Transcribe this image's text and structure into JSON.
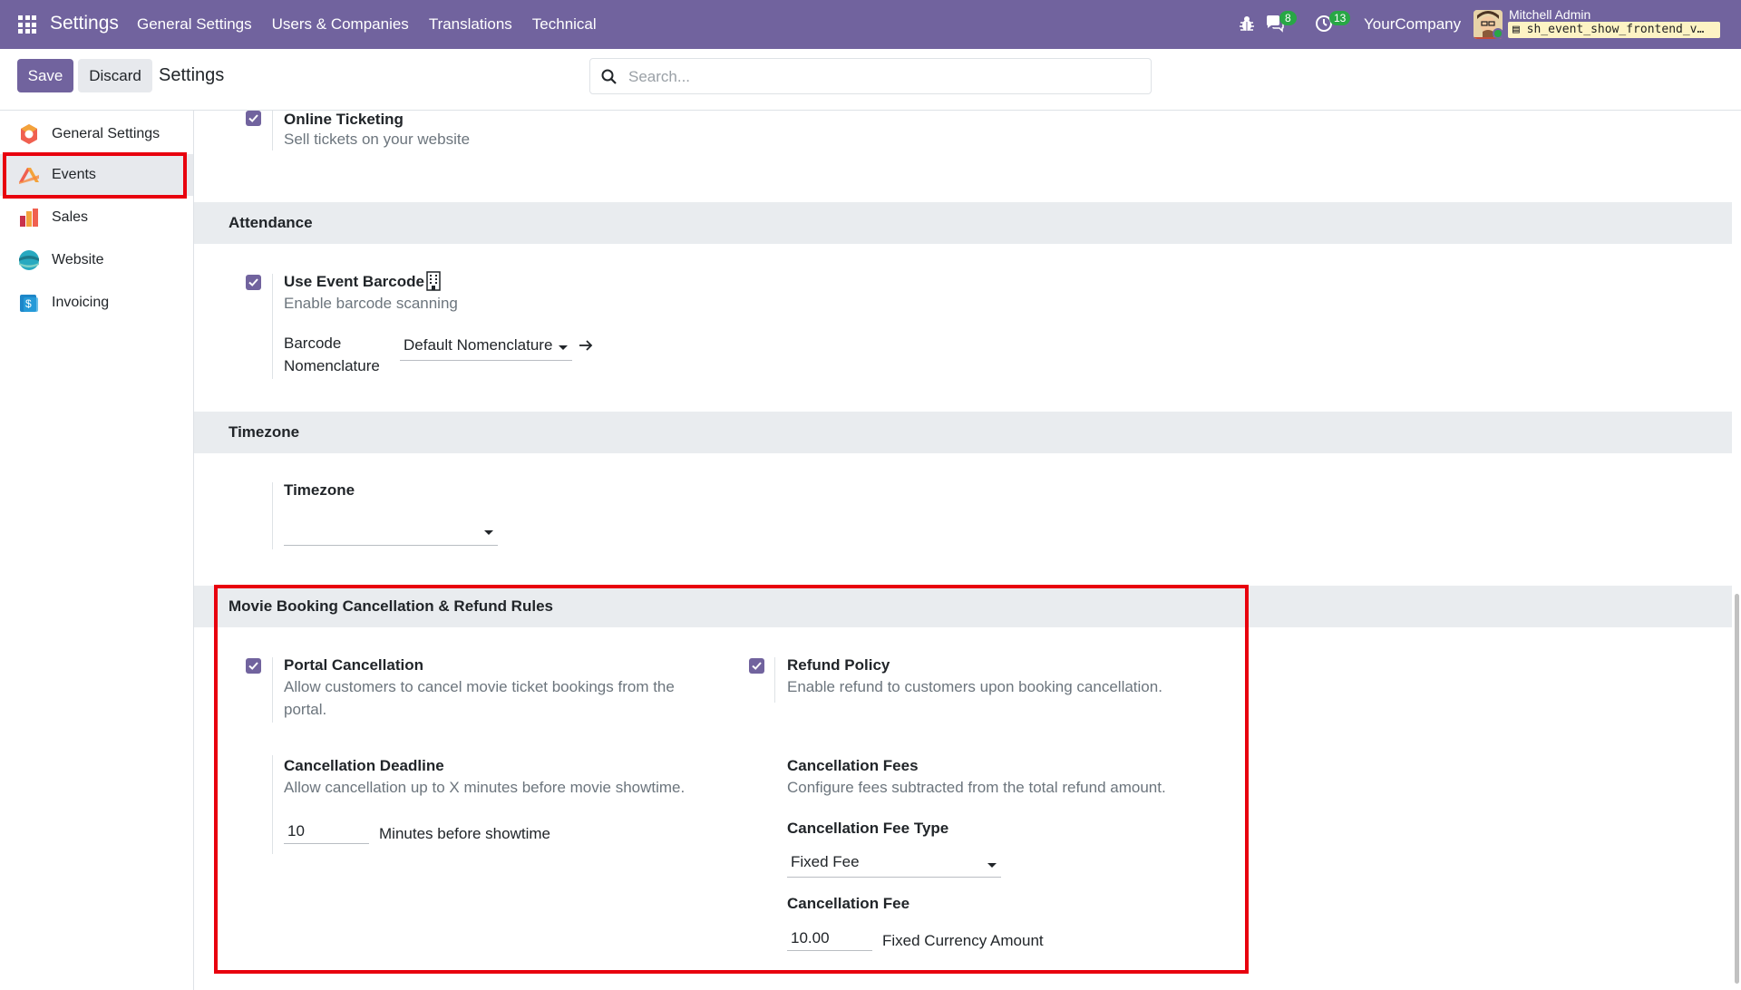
{
  "navbar": {
    "brand": "Settings",
    "menu": [
      "General Settings",
      "Users & Companies",
      "Translations",
      "Technical"
    ],
    "chat_count": "8",
    "activity_count": "13",
    "company": "YourCompany",
    "user_name": "Mitchell Admin",
    "db_name": "sh_event_show_frontend_v…",
    "bg_color": "#71639e"
  },
  "control_panel": {
    "save_label": "Save",
    "discard_label": "Discard",
    "title": "Settings",
    "search_placeholder": "Search..."
  },
  "sidebar": {
    "items": [
      {
        "label": "General Settings",
        "icon": "settings-app-icon"
      },
      {
        "label": "Events",
        "icon": "events-app-icon",
        "active": true
      },
      {
        "label": "Sales",
        "icon": "sales-app-icon"
      },
      {
        "label": "Website",
        "icon": "website-app-icon"
      },
      {
        "label": "Invoicing",
        "icon": "invoicing-app-icon"
      }
    ]
  },
  "main": {
    "online_ticketing": {
      "title": "Online Ticketing",
      "desc": "Sell tickets on your website",
      "checked": true
    },
    "attendance": {
      "header": "Attendance",
      "barcode_title": "Use Event Barcode",
      "barcode_desc": "Enable barcode scanning",
      "barcode_checked": true,
      "nomenclature_label_1": "Barcode",
      "nomenclature_label_2": "Nomenclature",
      "nomenclature_value": "Default Nomenclature"
    },
    "timezone": {
      "header": "Timezone",
      "label": "Timezone",
      "value": ""
    },
    "movie_rules": {
      "header": "Movie Booking Cancellation & Refund Rules",
      "portal_title": "Portal Cancellation",
      "portal_desc_1": "Allow customers to cancel movie ticket bookings from the",
      "portal_desc_2": "portal.",
      "portal_checked": true,
      "refund_title": "Refund Policy",
      "refund_desc": "Enable refund to customers upon booking cancellation.",
      "refund_checked": true,
      "deadline_title": "Cancellation Deadline",
      "deadline_desc": "Allow cancellation up to X minutes before movie showtime.",
      "deadline_value": "10",
      "deadline_unit": "Minutes before showtime",
      "fees_title": "Cancellation Fees",
      "fees_desc": "Configure fees subtracted from the total refund amount.",
      "fee_type_label": "Cancellation Fee Type",
      "fee_type_value": "Fixed Fee",
      "fee_label": "Cancellation Fee",
      "fee_value": "10.00",
      "fee_unit": "Fixed Currency Amount"
    }
  }
}
